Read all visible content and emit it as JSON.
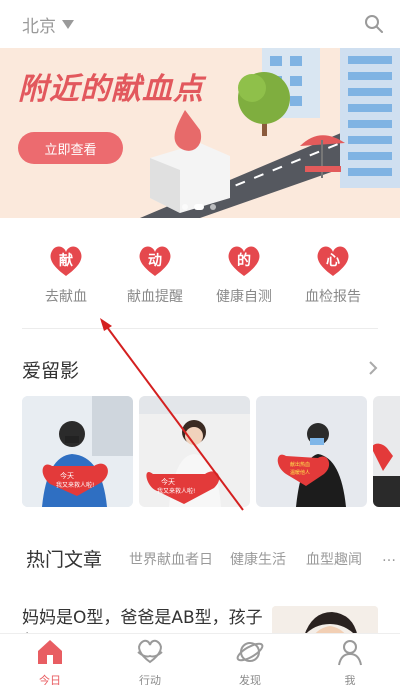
{
  "topbar": {
    "city": "北京",
    "search_icon": "search-icon"
  },
  "banner": {
    "title": "附近的献血点",
    "button_label": "立即查看",
    "colors": {
      "bg": "#fbe9dc",
      "title": "#e2585d",
      "button": "#ec6b6f"
    }
  },
  "quick_actions": [
    {
      "glyph": "献",
      "label": "去献血"
    },
    {
      "glyph": "动",
      "label": "献血提醒"
    },
    {
      "glyph": "的",
      "label": "健康自测"
    },
    {
      "glyph": "心",
      "label": "血检报告"
    }
  ],
  "love_photos": {
    "title": "爱留影",
    "photos": [
      {
        "sign_line1": "今天",
        "sign_line2": "我又来救人啦!"
      },
      {
        "sign_line1": "今天",
        "sign_line2": "我又来救人啦!"
      },
      {
        "sign_line1": "献出热血",
        "sign_line2": "温暖他人"
      },
      {
        "sign_line1": "",
        "sign_line2": ""
      }
    ]
  },
  "articles": {
    "tabs": {
      "main": "热门文章",
      "items": [
        "世界献血者日",
        "健康生活",
        "血型趣闻",
        "…"
      ]
    },
    "first_title": "妈妈是O型，爸爸是AB型，孩子却是AB，是不是…"
  },
  "bottom_nav": [
    {
      "label": "今日",
      "icon": "home-icon",
      "active": true
    },
    {
      "label": "行动",
      "icon": "heart-hands-icon",
      "active": false
    },
    {
      "label": "发现",
      "icon": "planet-icon",
      "active": false
    },
    {
      "label": "我",
      "icon": "person-icon",
      "active": false
    }
  ],
  "accent_color": "#e85d62"
}
